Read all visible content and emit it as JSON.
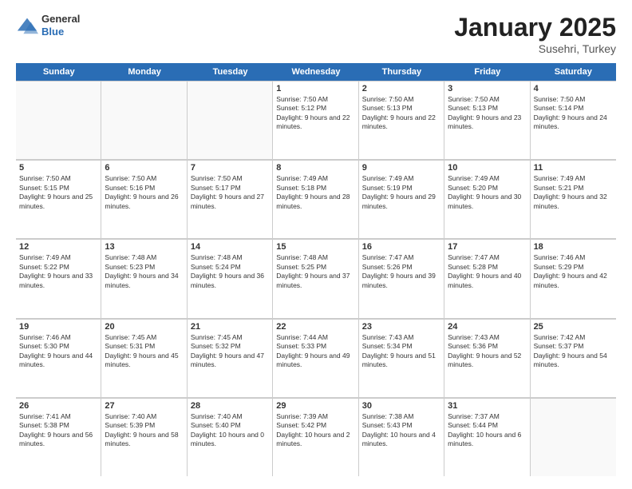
{
  "header": {
    "logo_general": "General",
    "logo_blue": "Blue",
    "title": "January 2025",
    "location": "Susehri, Turkey"
  },
  "days_of_week": [
    "Sunday",
    "Monday",
    "Tuesday",
    "Wednesday",
    "Thursday",
    "Friday",
    "Saturday"
  ],
  "weeks": [
    [
      {
        "day": "",
        "sunrise": "",
        "sunset": "",
        "daylight": ""
      },
      {
        "day": "",
        "sunrise": "",
        "sunset": "",
        "daylight": ""
      },
      {
        "day": "",
        "sunrise": "",
        "sunset": "",
        "daylight": ""
      },
      {
        "day": "1",
        "sunrise": "Sunrise: 7:50 AM",
        "sunset": "Sunset: 5:12 PM",
        "daylight": "Daylight: 9 hours and 22 minutes."
      },
      {
        "day": "2",
        "sunrise": "Sunrise: 7:50 AM",
        "sunset": "Sunset: 5:13 PM",
        "daylight": "Daylight: 9 hours and 22 minutes."
      },
      {
        "day": "3",
        "sunrise": "Sunrise: 7:50 AM",
        "sunset": "Sunset: 5:13 PM",
        "daylight": "Daylight: 9 hours and 23 minutes."
      },
      {
        "day": "4",
        "sunrise": "Sunrise: 7:50 AM",
        "sunset": "Sunset: 5:14 PM",
        "daylight": "Daylight: 9 hours and 24 minutes."
      }
    ],
    [
      {
        "day": "5",
        "sunrise": "Sunrise: 7:50 AM",
        "sunset": "Sunset: 5:15 PM",
        "daylight": "Daylight: 9 hours and 25 minutes."
      },
      {
        "day": "6",
        "sunrise": "Sunrise: 7:50 AM",
        "sunset": "Sunset: 5:16 PM",
        "daylight": "Daylight: 9 hours and 26 minutes."
      },
      {
        "day": "7",
        "sunrise": "Sunrise: 7:50 AM",
        "sunset": "Sunset: 5:17 PM",
        "daylight": "Daylight: 9 hours and 27 minutes."
      },
      {
        "day": "8",
        "sunrise": "Sunrise: 7:49 AM",
        "sunset": "Sunset: 5:18 PM",
        "daylight": "Daylight: 9 hours and 28 minutes."
      },
      {
        "day": "9",
        "sunrise": "Sunrise: 7:49 AM",
        "sunset": "Sunset: 5:19 PM",
        "daylight": "Daylight: 9 hours and 29 minutes."
      },
      {
        "day": "10",
        "sunrise": "Sunrise: 7:49 AM",
        "sunset": "Sunset: 5:20 PM",
        "daylight": "Daylight: 9 hours and 30 minutes."
      },
      {
        "day": "11",
        "sunrise": "Sunrise: 7:49 AM",
        "sunset": "Sunset: 5:21 PM",
        "daylight": "Daylight: 9 hours and 32 minutes."
      }
    ],
    [
      {
        "day": "12",
        "sunrise": "Sunrise: 7:49 AM",
        "sunset": "Sunset: 5:22 PM",
        "daylight": "Daylight: 9 hours and 33 minutes."
      },
      {
        "day": "13",
        "sunrise": "Sunrise: 7:48 AM",
        "sunset": "Sunset: 5:23 PM",
        "daylight": "Daylight: 9 hours and 34 minutes."
      },
      {
        "day": "14",
        "sunrise": "Sunrise: 7:48 AM",
        "sunset": "Sunset: 5:24 PM",
        "daylight": "Daylight: 9 hours and 36 minutes."
      },
      {
        "day": "15",
        "sunrise": "Sunrise: 7:48 AM",
        "sunset": "Sunset: 5:25 PM",
        "daylight": "Daylight: 9 hours and 37 minutes."
      },
      {
        "day": "16",
        "sunrise": "Sunrise: 7:47 AM",
        "sunset": "Sunset: 5:26 PM",
        "daylight": "Daylight: 9 hours and 39 minutes."
      },
      {
        "day": "17",
        "sunrise": "Sunrise: 7:47 AM",
        "sunset": "Sunset: 5:28 PM",
        "daylight": "Daylight: 9 hours and 40 minutes."
      },
      {
        "day": "18",
        "sunrise": "Sunrise: 7:46 AM",
        "sunset": "Sunset: 5:29 PM",
        "daylight": "Daylight: 9 hours and 42 minutes."
      }
    ],
    [
      {
        "day": "19",
        "sunrise": "Sunrise: 7:46 AM",
        "sunset": "Sunset: 5:30 PM",
        "daylight": "Daylight: 9 hours and 44 minutes."
      },
      {
        "day": "20",
        "sunrise": "Sunrise: 7:45 AM",
        "sunset": "Sunset: 5:31 PM",
        "daylight": "Daylight: 9 hours and 45 minutes."
      },
      {
        "day": "21",
        "sunrise": "Sunrise: 7:45 AM",
        "sunset": "Sunset: 5:32 PM",
        "daylight": "Daylight: 9 hours and 47 minutes."
      },
      {
        "day": "22",
        "sunrise": "Sunrise: 7:44 AM",
        "sunset": "Sunset: 5:33 PM",
        "daylight": "Daylight: 9 hours and 49 minutes."
      },
      {
        "day": "23",
        "sunrise": "Sunrise: 7:43 AM",
        "sunset": "Sunset: 5:34 PM",
        "daylight": "Daylight: 9 hours and 51 minutes."
      },
      {
        "day": "24",
        "sunrise": "Sunrise: 7:43 AM",
        "sunset": "Sunset: 5:36 PM",
        "daylight": "Daylight: 9 hours and 52 minutes."
      },
      {
        "day": "25",
        "sunrise": "Sunrise: 7:42 AM",
        "sunset": "Sunset: 5:37 PM",
        "daylight": "Daylight: 9 hours and 54 minutes."
      }
    ],
    [
      {
        "day": "26",
        "sunrise": "Sunrise: 7:41 AM",
        "sunset": "Sunset: 5:38 PM",
        "daylight": "Daylight: 9 hours and 56 minutes."
      },
      {
        "day": "27",
        "sunrise": "Sunrise: 7:40 AM",
        "sunset": "Sunset: 5:39 PM",
        "daylight": "Daylight: 9 hours and 58 minutes."
      },
      {
        "day": "28",
        "sunrise": "Sunrise: 7:40 AM",
        "sunset": "Sunset: 5:40 PM",
        "daylight": "Daylight: 10 hours and 0 minutes."
      },
      {
        "day": "29",
        "sunrise": "Sunrise: 7:39 AM",
        "sunset": "Sunset: 5:42 PM",
        "daylight": "Daylight: 10 hours and 2 minutes."
      },
      {
        "day": "30",
        "sunrise": "Sunrise: 7:38 AM",
        "sunset": "Sunset: 5:43 PM",
        "daylight": "Daylight: 10 hours and 4 minutes."
      },
      {
        "day": "31",
        "sunrise": "Sunrise: 7:37 AM",
        "sunset": "Sunset: 5:44 PM",
        "daylight": "Daylight: 10 hours and 6 minutes."
      },
      {
        "day": "",
        "sunrise": "",
        "sunset": "",
        "daylight": ""
      }
    ]
  ]
}
